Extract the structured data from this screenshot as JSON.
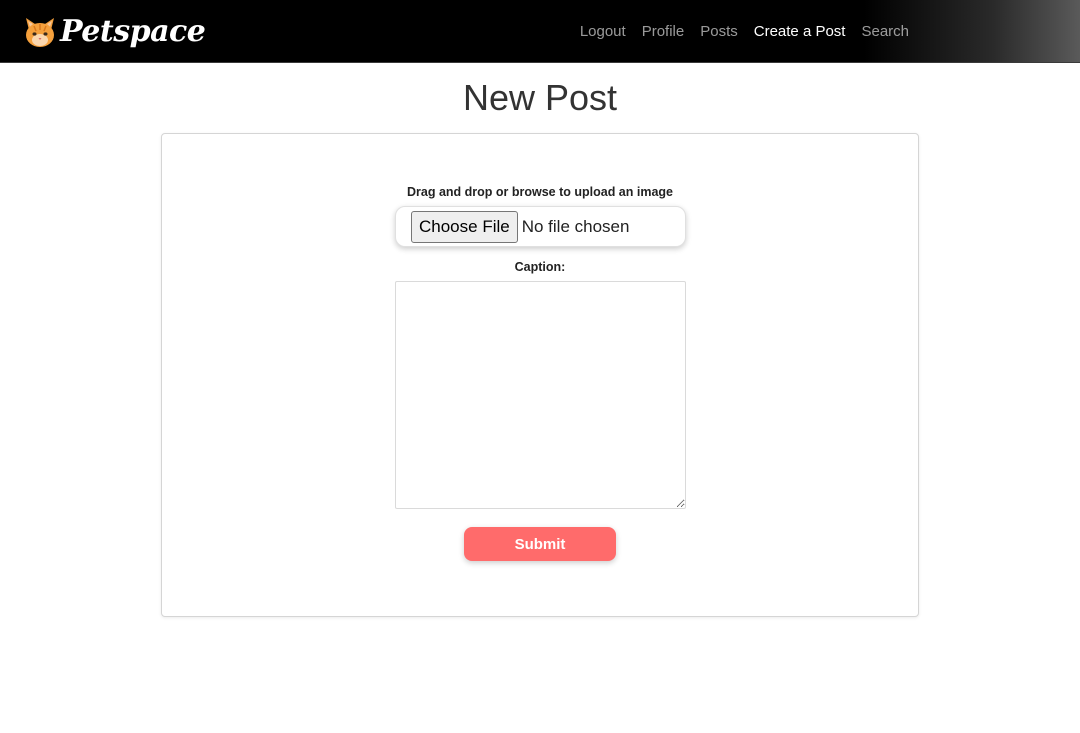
{
  "navbar": {
    "brand": "Petspace",
    "logo_icon": "cat-face-icon",
    "links": [
      {
        "label": "Logout",
        "active": false
      },
      {
        "label": "Profile",
        "active": false
      },
      {
        "label": "Posts",
        "active": false
      },
      {
        "label": "Create a Post",
        "active": true
      },
      {
        "label": "Search",
        "active": false
      }
    ]
  },
  "page": {
    "title": "New Post"
  },
  "form": {
    "upload_label": "Drag and drop or browse to upload an image",
    "file_button_label": "Choose File",
    "file_status": "No file chosen",
    "caption_label": "Caption:",
    "caption_value": "",
    "submit_label": "Submit"
  },
  "colors": {
    "navbar_bg": "#000000",
    "submit_bg": "#ff6b6b",
    "logo_orange": "#f5a03c"
  }
}
